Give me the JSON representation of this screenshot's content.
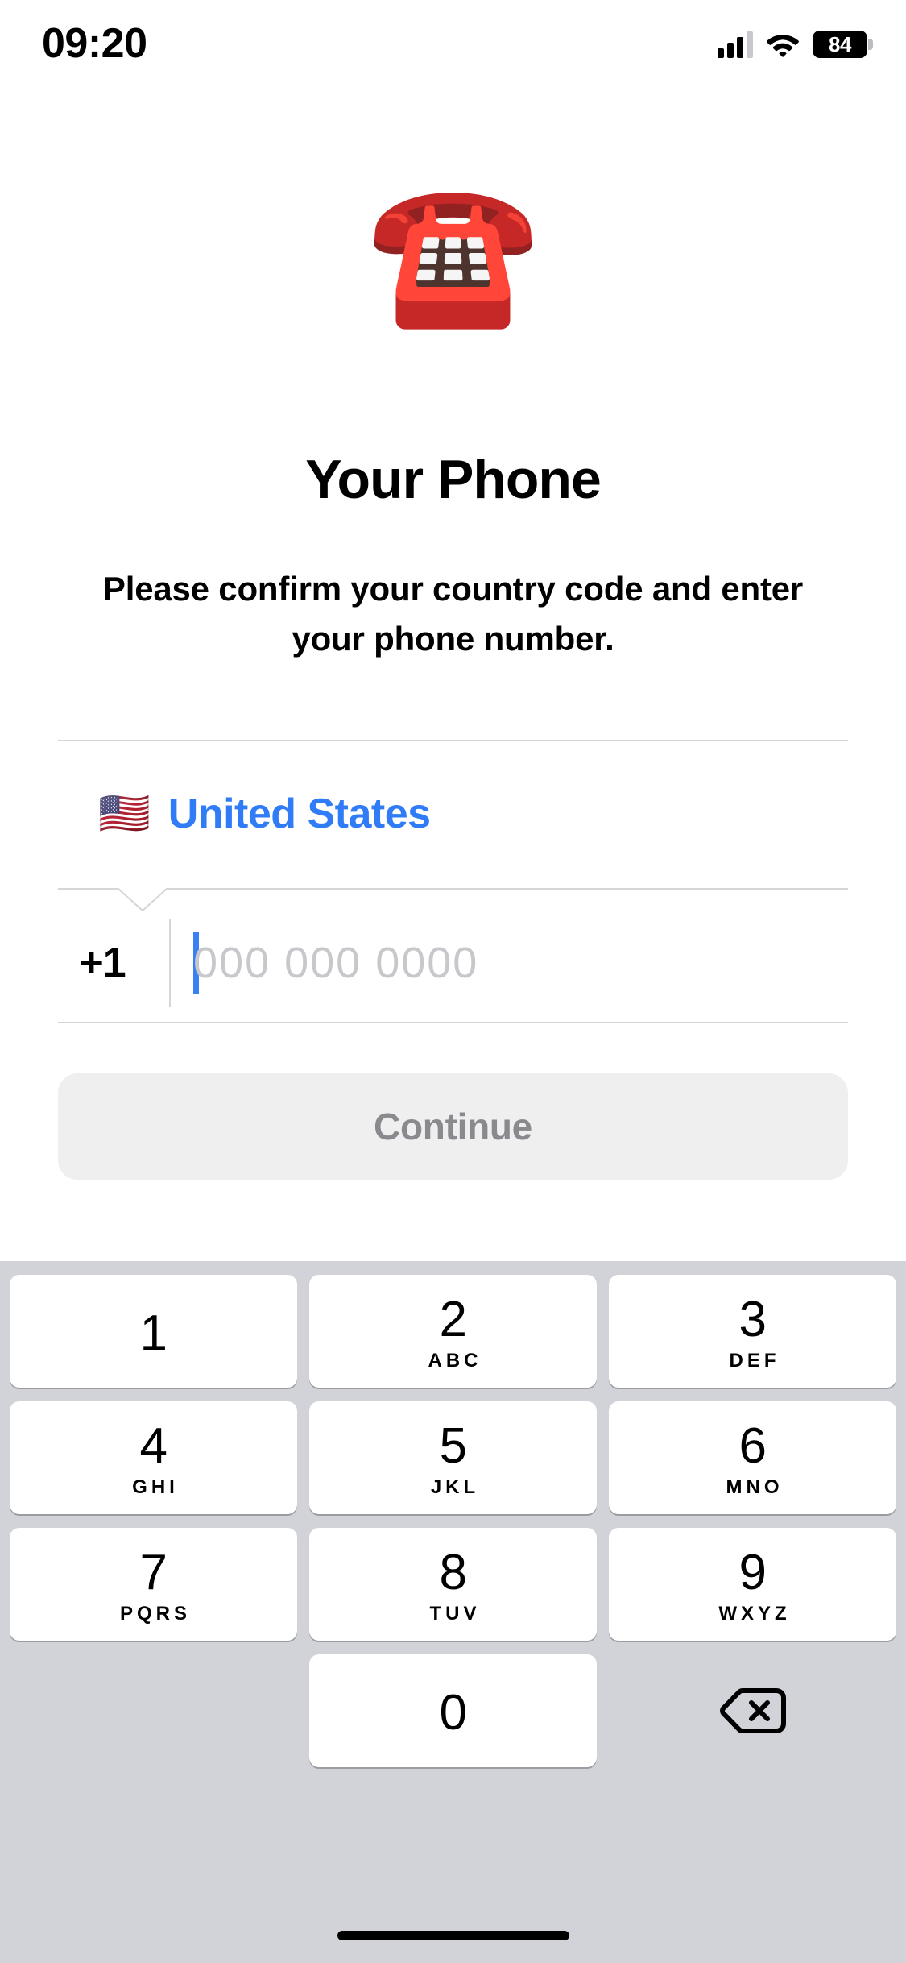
{
  "status_bar": {
    "time": "09:20",
    "battery_percent": "84",
    "signal_icon": "cellular-signal-icon",
    "wifi_icon": "wifi-icon",
    "battery_icon": "battery-icon"
  },
  "hero": {
    "emoji": "☎️",
    "emoji_name": "telephone-emoji",
    "title": "Your Phone",
    "subtitle": "Please confirm your country code and enter your phone number."
  },
  "form": {
    "country": {
      "flag_emoji": "🇺🇸",
      "flag_name": "flag-united-states-emoji",
      "name": "United States",
      "accent_color": "#2f7cf6"
    },
    "dial_code": "+1",
    "phone_value": "",
    "phone_placeholder": "000 000 0000",
    "caret_color": "#3b7ff5",
    "placeholder_color": "#c7c7cc"
  },
  "actions": {
    "continue_label": "Continue",
    "continue_enabled": false,
    "continue_bg": "#efeff0",
    "continue_text_color": "#8a8a8e"
  },
  "keypad": {
    "background_color": "#d1d3d9",
    "key_color": "#ffffff",
    "rows": [
      [
        {
          "digit": "1",
          "letters": ""
        },
        {
          "digit": "2",
          "letters": "ABC"
        },
        {
          "digit": "3",
          "letters": "DEF"
        }
      ],
      [
        {
          "digit": "4",
          "letters": "GHI"
        },
        {
          "digit": "5",
          "letters": "JKL"
        },
        {
          "digit": "6",
          "letters": "MNO"
        }
      ],
      [
        {
          "digit": "7",
          "letters": "PQRS"
        },
        {
          "digit": "8",
          "letters": "TUV"
        },
        {
          "digit": "9",
          "letters": "WXYZ"
        }
      ]
    ],
    "zero_key": {
      "digit": "0",
      "letters": ""
    },
    "delete_icon": "backspace-delete-icon"
  },
  "system": {
    "home_indicator": "home-indicator"
  }
}
